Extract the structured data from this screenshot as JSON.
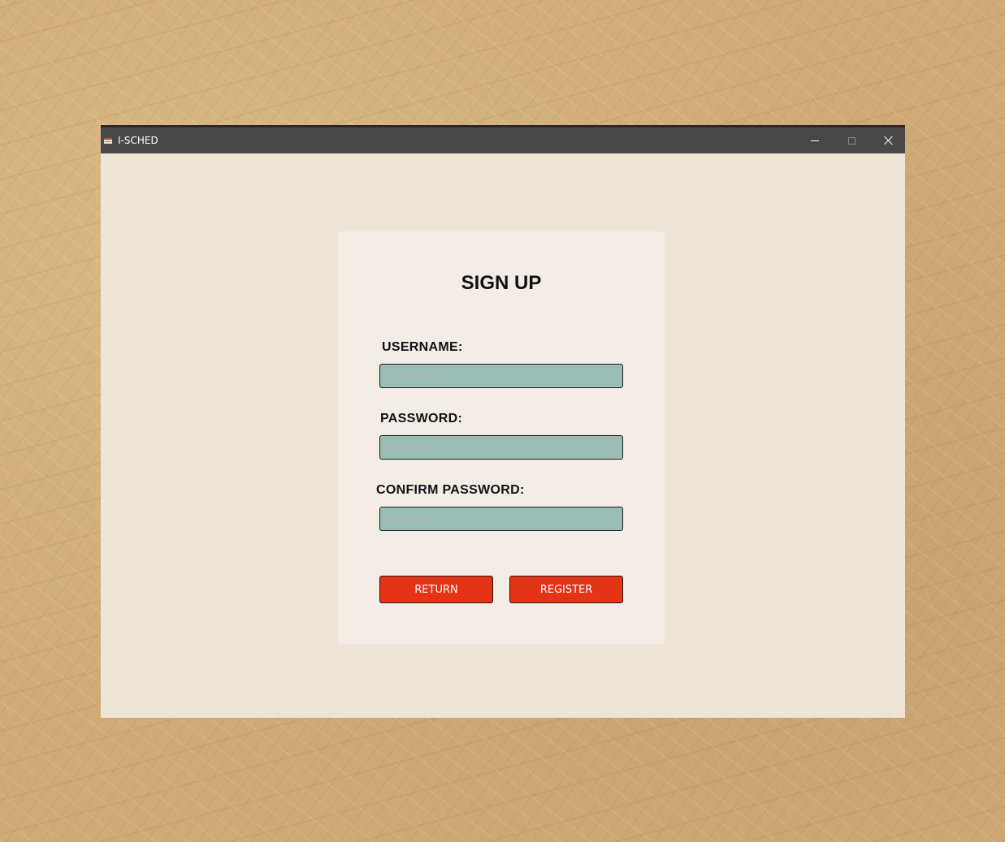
{
  "window": {
    "title": "I-SCHED",
    "icon": "calendar-icon",
    "controls": {
      "minimize": "minimize-icon",
      "maximize": "maximize-icon",
      "close": "close-icon"
    }
  },
  "form": {
    "heading": "SIGN UP",
    "username": {
      "label": "USERNAME:",
      "placeholder": "Username",
      "value": ""
    },
    "password": {
      "label": "PASSWORD:",
      "placeholder": "Password",
      "value": ""
    },
    "confirm_password": {
      "label": "CONFIRM PASSWORD:",
      "placeholder": "Password",
      "value": ""
    },
    "buttons": {
      "return_label": "RETURN",
      "register_label": "REGISTER"
    }
  },
  "colors": {
    "titlebar": "#4a4847",
    "window_bg": "#efe5d6",
    "card_bg": "#f3ede6",
    "field_bg": "#9bbbb5",
    "button_bg": "#e53315",
    "desktop_bg": "#cfa976"
  }
}
